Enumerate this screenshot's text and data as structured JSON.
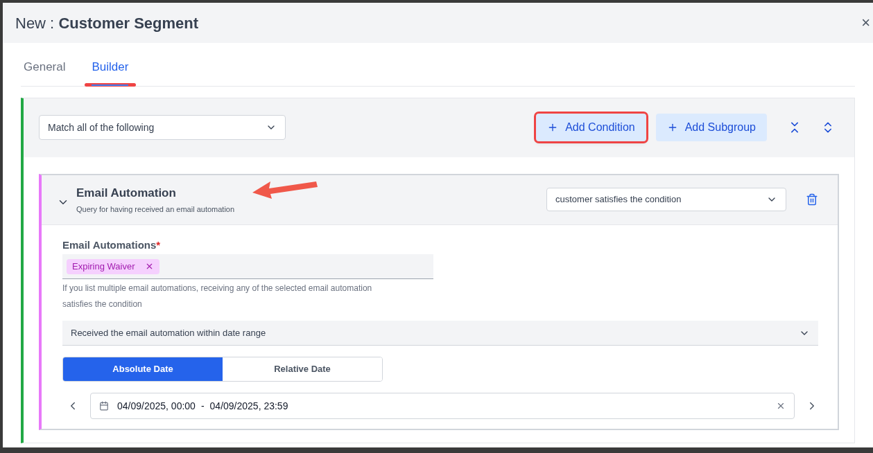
{
  "window": {
    "prefix": "New :",
    "title": "Customer Segment",
    "close": "×"
  },
  "tabs": [
    {
      "label": "General",
      "selected": false
    },
    {
      "label": "Builder",
      "selected": true
    }
  ],
  "group": {
    "match": "Match all of the following",
    "buttons": [
      {
        "label": "Add Condition",
        "highlighted": true
      },
      {
        "label": "Add Subgroup",
        "highlighted": false
      }
    ]
  },
  "condition": {
    "expanded": true,
    "title": "Email Automation",
    "subtitle": "Query for having received an email automation",
    "mode": "customer satisfies the condition",
    "field": {
      "label": "Email Automations",
      "required_mark": "*",
      "tags": [
        "Expiring Waiver"
      ],
      "help": "If you list multiple email automations, receiving any of the selected email automation satisfies the condition"
    },
    "timing": "Received the email automation within date range",
    "date_modes": [
      {
        "label": "Absolute Date",
        "selected": true
      },
      {
        "label": "Relative Date",
        "selected": false
      }
    ],
    "range": {
      "start": "04/09/2025, 00:00",
      "separator": "-",
      "end": "04/09/2025, 23:59"
    }
  }
}
